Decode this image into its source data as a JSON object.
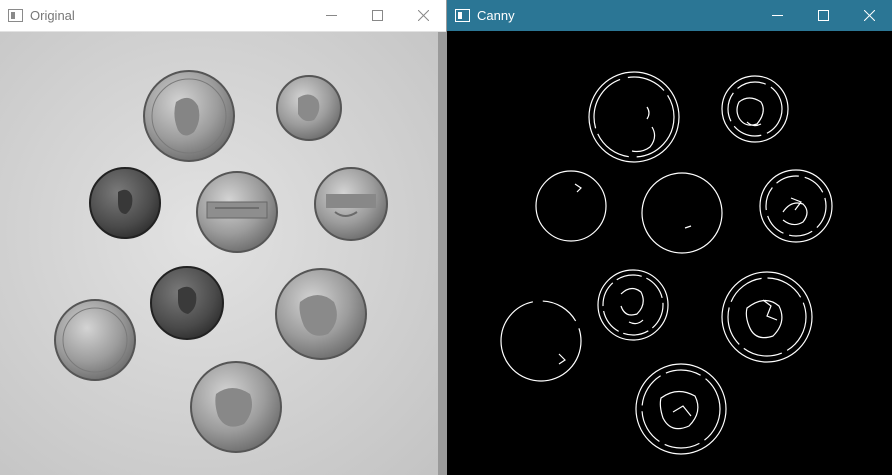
{
  "windows": {
    "original": {
      "title": "Original",
      "icons": {
        "app": "window-icon",
        "minimize": "minimize-icon",
        "maximize": "maximize-icon",
        "close": "close-icon"
      }
    },
    "canny": {
      "title": "Canny",
      "icons": {
        "app": "window-icon",
        "minimize": "minimize-icon",
        "maximize": "maximize-icon",
        "close": "close-icon"
      }
    }
  },
  "colors": {
    "canny_titlebar": "#2b7695",
    "photo_background": "#d6d6d6",
    "edge_lines": "#ffffff"
  },
  "images": {
    "original": {
      "kind": "grayscale photograph of nine coins"
    },
    "canny": {
      "kind": "canny edge map of nine coins"
    }
  }
}
